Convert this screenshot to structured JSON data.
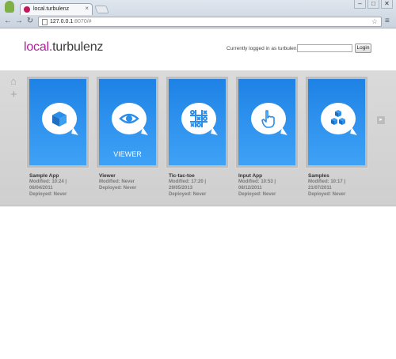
{
  "browser": {
    "tab_title": "local.turbulenz",
    "tab_close": "×",
    "url_host": "127.0.0.1",
    "url_path": ":8070/#",
    "controls": {
      "minimize": "–",
      "maximize": "□",
      "close": "✕"
    }
  },
  "header": {
    "logo_part1": "local",
    "logo_dot": ".",
    "logo_part2": "turbulenz",
    "login_status": "Currently logged in as turbulenz",
    "login_button": "Login"
  },
  "projects": [
    {
      "name": "Sample App",
      "modified": "Modified: 10:24 | 08/04/2011",
      "deployed": "Deployed: Never",
      "icon": "cube-icon",
      "caption": ""
    },
    {
      "name": "Viewer",
      "modified": "Modified: Never",
      "deployed": "Deployed: Never",
      "icon": "eye-icon",
      "caption": "VIEWER"
    },
    {
      "name": "Tic-tac-toe",
      "modified": "Modified: 17:20 | 29/05/2013",
      "deployed": "Deployed: Never",
      "icon": "tic-tac-toe-icon",
      "caption": ""
    },
    {
      "name": "Input App",
      "modified": "Modified: 10:53 | 08/12/2011",
      "deployed": "Deployed: Never",
      "icon": "pointer-hand-icon",
      "caption": ""
    },
    {
      "name": "Samples",
      "modified": "Modified: 10:17 | 21/07/2011",
      "deployed": "Deployed: Never",
      "icon": "cubes-icon",
      "caption": ""
    }
  ],
  "colors": {
    "tile_blue": "#2a8ff0",
    "logo_magenta": "#b0209a"
  }
}
